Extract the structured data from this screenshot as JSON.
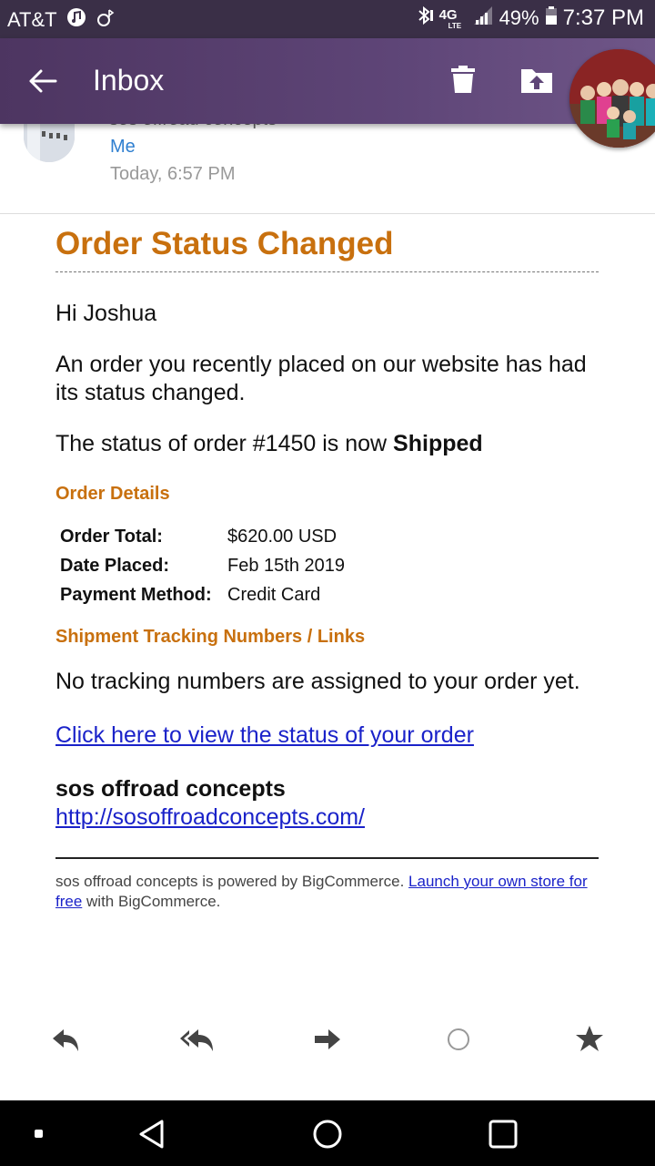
{
  "status_bar": {
    "carrier": "AT&T",
    "network": "4G",
    "network_sub": "LTE",
    "battery": "49%",
    "time": "7:37 PM"
  },
  "app_bar": {
    "title": "Inbox"
  },
  "email_header": {
    "sender": "sos offroad concepts",
    "recipient": "Me",
    "date": "Today, 6:57 PM"
  },
  "email": {
    "title": "Order Status Changed",
    "greeting": "Hi Joshua",
    "intro": "An order you recently placed on our website has had its status changed.",
    "status_prefix": "The status of order #1450 is now ",
    "status_value": "Shipped",
    "order_details_heading": "Order Details",
    "order_details": [
      {
        "label": "Order Total:",
        "value": "$620.00 USD"
      },
      {
        "label": "Date Placed:",
        "value": "Feb 15th 2019"
      },
      {
        "label": "Payment Method:",
        "value": "Credit Card"
      }
    ],
    "tracking_heading": "Shipment Tracking Numbers / Links",
    "tracking_text": "No tracking numbers are assigned to your order yet.",
    "status_link": "Click here to view the status of your order",
    "company": "sos offroad concepts",
    "company_url": "http://sosoffroadconcepts.com/",
    "footer_prefix": "sos offroad concepts is powered by BigCommerce. ",
    "footer_link": "Launch your own store for free",
    "footer_suffix": " with BigCommerce."
  },
  "icons": {
    "reply": "reply-icon",
    "reply_all": "reply-all-icon",
    "forward": "forward-icon",
    "mark": "circle-icon",
    "star": "star-icon"
  },
  "colors": {
    "app_bar": "#5e4577",
    "status_bar": "#3a2f47",
    "heading_orange": "#c8700e",
    "link_blue": "#1a22c9",
    "recipient_blue": "#2f7fd0"
  }
}
